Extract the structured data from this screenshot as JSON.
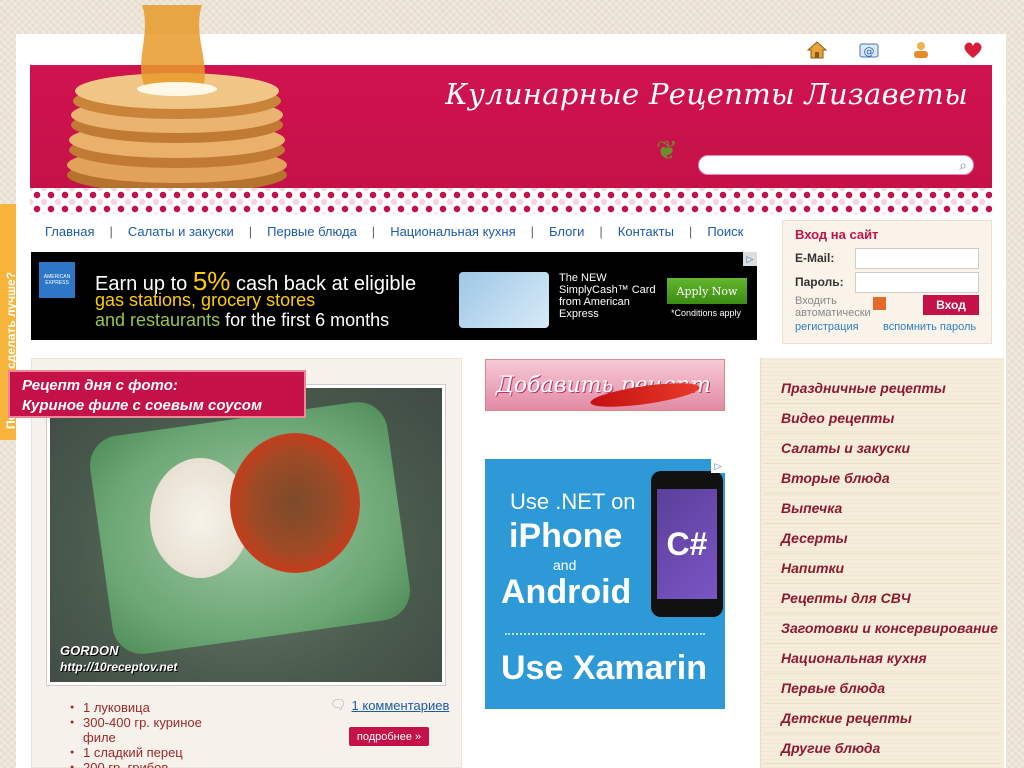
{
  "header": {
    "site_title": "Кулинарные Рецепты Лизаветы",
    "top_icons": [
      "home-icon",
      "email-icon",
      "users-icon",
      "heart-icon"
    ]
  },
  "nav": {
    "items": [
      "Главная",
      "Салаты и закуски",
      "Первые блюда",
      "Национальная кухня",
      "Блоги",
      "Контакты",
      "Поиск"
    ],
    "separator": "|"
  },
  "ad_top": {
    "line1_pre": "Earn up to ",
    "line1_highlight": "5%",
    "line1_post": " cash back at eligible",
    "line2": "gas stations, grocery stores",
    "line3_a": "and restaurants",
    "line3_b": " for the first 6 months",
    "card_text": "The NEW SimplyCash™ Card from American Express",
    "apply_label": "Apply Now",
    "conditions": "*Conditions apply",
    "logo_text": "AMERICAN EXPRESS"
  },
  "login": {
    "title": "Вход на сайт",
    "email_label": "E-Mail:",
    "password_label": "Пароль:",
    "auto_login": "Входить автоматически",
    "submit": "Вход",
    "register": "регистрация",
    "forgot": "вспомнить пароль"
  },
  "recipe_of_day": {
    "label_line1": "Рецепт дня с фото:",
    "label_line2": "Куриное филе с соевым соусом",
    "watermark1": "GORDON",
    "watermark2": "http://10receptov.net",
    "ingredients": [
      "1 луковица",
      "300-400 гр. куриное филе",
      "1 сладкий перец",
      "200 гр. грибов"
    ],
    "comments_link": "1 комментариев",
    "more_button": "подробнее »"
  },
  "add_recipe": {
    "label": "Добавить рецепт"
  },
  "ad_side": {
    "line1": "Use .NET on",
    "line2": "iPhone",
    "line3": "and",
    "line4": "Android",
    "line5": "Use Xamarin",
    "screen_text": "C#"
  },
  "categories": [
    "Праздничные рецепты",
    "Видео рецепты",
    "Салаты и закуски",
    "Вторые блюда",
    "Выпечка",
    "Десерты",
    "Напитки",
    "Рецепты для СВЧ",
    "Заготовки и консервирование",
    "Национальная кухня",
    "Первые блюда",
    "Детские рецепты",
    "Другие блюда"
  ],
  "feedback_tab": "Помогите сделать лучше?"
}
